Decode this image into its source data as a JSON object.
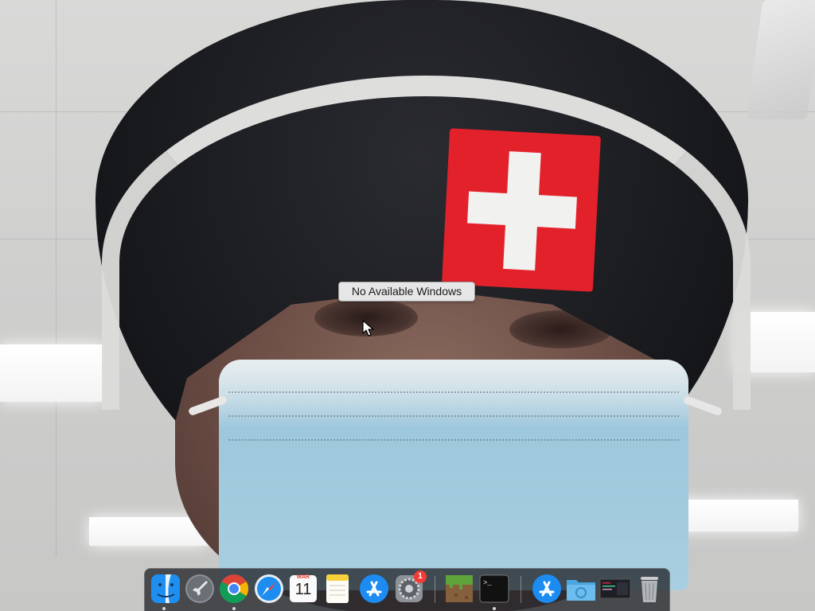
{
  "tooltip": {
    "text": "No Available Windows"
  },
  "dock": {
    "items": [
      {
        "name": "Finder",
        "icon": "finder-icon",
        "running": true
      },
      {
        "name": "Launchpad",
        "icon": "rocket-icon",
        "running": false
      },
      {
        "name": "Google Chrome",
        "icon": "chrome-icon",
        "running": true
      },
      {
        "name": "Safari",
        "icon": "compass-icon",
        "running": false
      },
      {
        "name": "Calendar",
        "icon": "calendar-icon",
        "running": false,
        "month": "MAR",
        "day": "11"
      },
      {
        "name": "Notes",
        "icon": "notes-icon",
        "running": false
      },
      {
        "name": "App Store",
        "icon": "app-store-icon",
        "running": false
      },
      {
        "name": "System Preferences",
        "icon": "gear-icon",
        "running": false,
        "badge": "1"
      },
      {
        "name": "Minecraft",
        "icon": "grass-block-icon",
        "running": false
      },
      {
        "name": "Terminal",
        "icon": "terminal-icon",
        "running": true,
        "prompt": ">_"
      },
      {
        "name": "Applications",
        "icon": "app-store-icon",
        "running": false
      },
      {
        "name": "Downloads",
        "icon": "folder-icon",
        "running": false
      },
      {
        "name": "Recent Document",
        "icon": "screenshot-thumbnail-icon",
        "running": false
      },
      {
        "name": "Trash",
        "icon": "trash-icon",
        "running": false
      }
    ]
  },
  "colors": {
    "flag_red": "#e3212b",
    "dock_background": "#23252a",
    "tooltip_background": "#e6e6e6",
    "badge_red": "#f43c35"
  }
}
